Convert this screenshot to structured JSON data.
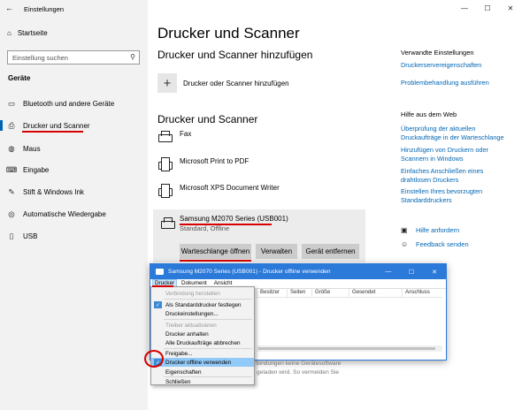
{
  "window": {
    "title": "Einstellungen",
    "controls": [
      "—",
      "☐",
      "✕"
    ]
  },
  "sidebar": {
    "home": "Startseite",
    "search_placeholder": "Einstellung suchen",
    "section": "Geräte",
    "items": [
      {
        "label": "Bluetooth und andere Geräte",
        "icon": "bluetooth-icon"
      },
      {
        "label": "Drucker und Scanner",
        "icon": "printer-icon",
        "active": true
      },
      {
        "label": "Maus",
        "icon": "mouse-icon"
      },
      {
        "label": "Eingabe",
        "icon": "keyboard-icon"
      },
      {
        "label": "Stift & Windows Ink",
        "icon": "pen-icon"
      },
      {
        "label": "Automatische Wiedergabe",
        "icon": "autoplay-icon"
      },
      {
        "label": "USB",
        "icon": "usb-icon"
      }
    ]
  },
  "main": {
    "title": "Drucker und Scanner",
    "add_heading": "Drucker und Scanner hinzufügen",
    "add_label": "Drucker oder Scanner hinzufügen",
    "list_heading": "Drucker und Scanner",
    "printers": [
      {
        "name": "Fax"
      },
      {
        "name": "Microsoft Print to PDF"
      },
      {
        "name": "Microsoft XPS Document Writer"
      }
    ],
    "selected": {
      "name": "Samsung M2070 Series (USB001)",
      "status": "Standard, Offline",
      "buttons": [
        "Warteschlange öffnen",
        "Verwalten",
        "Gerät entfernen"
      ]
    }
  },
  "right": {
    "related_heading": "Verwandte Einstellungen",
    "related_links": [
      "Druckerservereigenschaften",
      "Problembehandlung ausführen"
    ],
    "help_heading": "Hilfe aus dem Web",
    "help_links": [
      "Überprüfung der aktuellen Druckaufträge in der Warteschlange",
      "Hinzufügen von Druckern oder Scannern in Windows",
      "Einfaches Anschließen eines drahtlosen Druckers",
      "Einstellen Ihres bevorzugten Standarddruckers"
    ],
    "bottom_links": [
      {
        "label": "Hilfe anfordern",
        "icon": "help-icon"
      },
      {
        "label": "Feedback senden",
        "icon": "feedback-icon"
      }
    ]
  },
  "dialog": {
    "title": "Samsung M2070 Series (USB001) - Drucker offline verwenden",
    "menu": [
      "Drucker",
      "Dokument",
      "Ansicht"
    ],
    "columns": [
      "Besitzer",
      "Seiten",
      "Größe",
      "Gesendet",
      "Anschluss"
    ],
    "context_menu": [
      {
        "label": "Verbindung herstellen",
        "disabled": true
      },
      {
        "label": "Als Standarddrucker festlegen",
        "checked": true
      },
      {
        "label": "Druckeinstellungen..."
      },
      {
        "label": "Treiber aktualisieren",
        "disabled": true
      },
      {
        "label": "Drucker anhalten"
      },
      {
        "label": "Alle Druckaufträge abbrechen"
      },
      {
        "label": "Freigabe..."
      },
      {
        "label": "Drucker offline verwenden",
        "checked": true,
        "highlighted": true
      },
      {
        "label": "Eigenschaften"
      },
      {
        "label": "Schließen"
      }
    ],
    "background_text": [
      "bindungen keine Gerätesoftware",
      "geladen wird. So vermeiden Sie"
    ]
  }
}
